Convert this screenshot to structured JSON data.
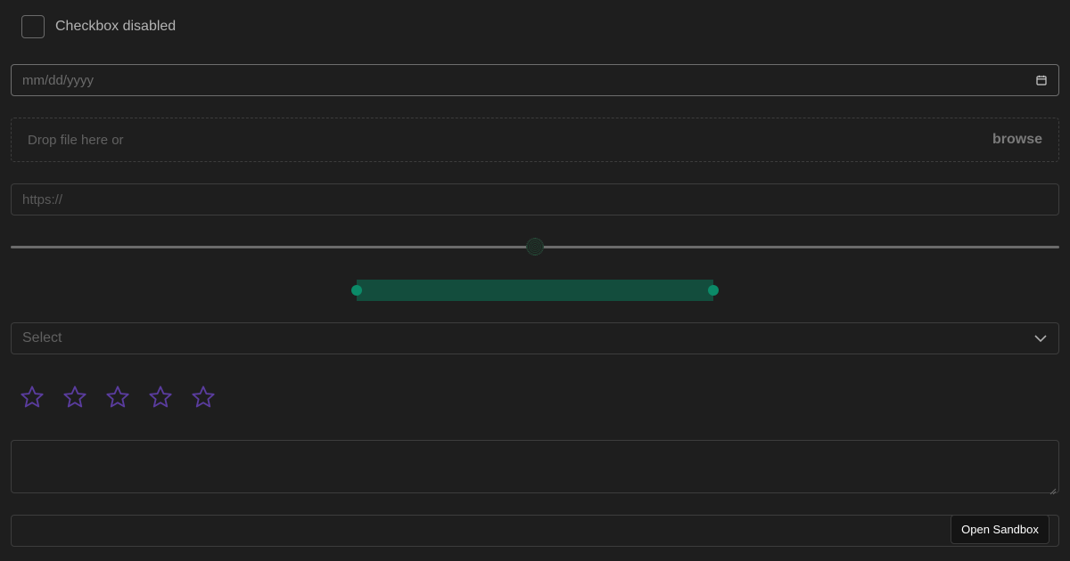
{
  "checkbox": {
    "label": "Checkbox disabled",
    "checked": false,
    "disabled": true
  },
  "date_input": {
    "placeholder": "mm/dd/yyyy",
    "icon": "calendar-icon"
  },
  "file_drop": {
    "text": "Drop file here or",
    "browse_label": "browse"
  },
  "url_input": {
    "placeholder": "https://"
  },
  "slider": {
    "value_fraction": 0.5
  },
  "range_slider": {
    "start_fraction": 0.33,
    "end_fraction": 0.67,
    "accent": "#0b8a68",
    "fill": "#134d3d"
  },
  "select": {
    "placeholder": "Select",
    "icon": "chevron-down-icon"
  },
  "rating": {
    "max": 5,
    "value": 0,
    "star_color": "#5a3c9e"
  },
  "textarea": {
    "value": ""
  },
  "bottom_input": {
    "value": ""
  },
  "sandbox": {
    "label": "Open Sandbox"
  },
  "colors": {
    "background": "#1e1e1e",
    "border": "#3d3d3d",
    "accent": "#0b8a68"
  }
}
